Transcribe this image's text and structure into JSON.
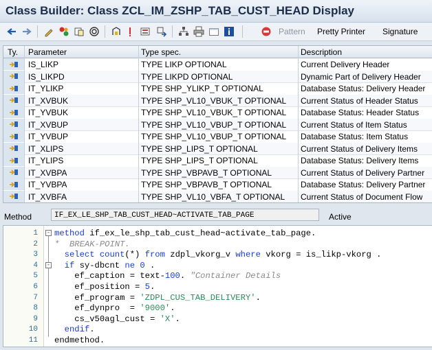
{
  "window": {
    "title": "Class Builder: Class ZCL_IM_ZSHP_TAB_CUST_HEAD Display"
  },
  "toolbar": {
    "icons": [
      "back-icon",
      "forward-icon",
      "edit-icon",
      "display-change-icon",
      "activate-icon",
      "where-used-icon",
      "test-icon",
      "object-list-icon",
      "breakpoint-icon",
      "navigate-icon",
      "hierarchy-icon",
      "print-icon",
      "fullscreen-icon",
      "info-icon",
      "pattern-icon"
    ],
    "pattern_label": "Pattern",
    "pretty_printer_label": "Pretty Printer",
    "signature_label": "Signature"
  },
  "params": {
    "headers": {
      "ty": "Ty.",
      "parameter": "Parameter",
      "type_spec": "Type spec.",
      "description": "Description"
    },
    "rows": [
      {
        "name": "IS_LIKP",
        "type": "TYPE LIKP OPTIONAL",
        "desc": "Current Delivery Header"
      },
      {
        "name": "IS_LIKPD",
        "type": "TYPE LIKPD OPTIONAL",
        "desc": "Dynamic Part of Delivery Header"
      },
      {
        "name": "IT_YLIKP",
        "type": "TYPE SHP_YLIKP_T OPTIONAL",
        "desc": "Database Status: Delivery Header"
      },
      {
        "name": "IT_XVBUK",
        "type": "TYPE SHP_VL10_VBUK_T OPTIONAL",
        "desc": "Current Status of Header Status"
      },
      {
        "name": "IT_YVBUK",
        "type": "TYPE SHP_VL10_VBUK_T OPTIONAL",
        "desc": "Database Status: Header Status"
      },
      {
        "name": "IT_XVBUP",
        "type": "TYPE SHP_VL10_VBUP_T OPTIONAL",
        "desc": "Current Status of Item Status"
      },
      {
        "name": "IT_YVBUP",
        "type": "TYPE SHP_VL10_VBUP_T OPTIONAL",
        "desc": "Database Status: Item Status"
      },
      {
        "name": "IT_XLIPS",
        "type": "TYPE SHP_LIPS_T OPTIONAL",
        "desc": "Current Status of Delivery Items"
      },
      {
        "name": "IT_YLIPS",
        "type": "TYPE SHP_LIPS_T OPTIONAL",
        "desc": "Database Status: Delivery Items"
      },
      {
        "name": "IT_XVBPA",
        "type": "TYPE SHP_VBPAVB_T OPTIONAL",
        "desc": "Current Status of Delivery Partner"
      },
      {
        "name": "IT_YVBPA",
        "type": "TYPE SHP_VBPAVB_T OPTIONAL",
        "desc": "Database Status: Delivery Partner"
      },
      {
        "name": "IT_XVBFA",
        "type": "TYPE SHP_VL10_VBFA_T OPTIONAL",
        "desc": "Current Status of Document Flow"
      }
    ]
  },
  "method_bar": {
    "label": "Method",
    "value": "IF_EX_LE_SHP_TAB_CUST_HEAD~ACTIVATE_TAB_PAGE",
    "status": "Active"
  },
  "editor": {
    "line_numbers": [
      "1",
      "2",
      "3",
      "4",
      "5",
      "6",
      "7",
      "8",
      "9",
      "10",
      "11"
    ],
    "lines": [
      [
        {
          "t": "method",
          "c": "kw"
        },
        {
          "t": " if_ex_le_shp_tab_cust_head~activate_tab_page.",
          "c": "id"
        }
      ],
      [
        {
          "t": "*  BREAK-POINT.",
          "c": "cm"
        }
      ],
      [
        {
          "t": "  ",
          "c": "id"
        },
        {
          "t": "select count",
          "c": "kw"
        },
        {
          "t": "(*) ",
          "c": "id"
        },
        {
          "t": "from",
          "c": "kw"
        },
        {
          "t": " zdpl_vkorg_v ",
          "c": "id"
        },
        {
          "t": "where",
          "c": "kw"
        },
        {
          "t": " vkorg = is_likp-vkorg .",
          "c": "id"
        }
      ],
      [
        {
          "t": "  ",
          "c": "id"
        },
        {
          "t": "if",
          "c": "kw"
        },
        {
          "t": " sy-dbcnt ",
          "c": "id"
        },
        {
          "t": "ne",
          "c": "kw"
        },
        {
          "t": " ",
          "c": "id"
        },
        {
          "t": "0",
          "c": "num"
        },
        {
          "t": " .",
          "c": "id"
        }
      ],
      [
        {
          "t": "    ef_caption = text-",
          "c": "id"
        },
        {
          "t": "100",
          "c": "num"
        },
        {
          "t": ". ",
          "c": "id"
        },
        {
          "t": "\"Container Details",
          "c": "cm"
        }
      ],
      [
        {
          "t": "    ef_position = ",
          "c": "id"
        },
        {
          "t": "5",
          "c": "num"
        },
        {
          "t": ".",
          "c": "id"
        }
      ],
      [
        {
          "t": "    ef_program = ",
          "c": "id"
        },
        {
          "t": "'ZDPL_CUS_TAB_DELIVERY'",
          "c": "str"
        },
        {
          "t": ".",
          "c": "id"
        }
      ],
      [
        {
          "t": "    ef_dynpro  = ",
          "c": "id"
        },
        {
          "t": "'9000'",
          "c": "str"
        },
        {
          "t": ".",
          "c": "id"
        }
      ],
      [
        {
          "t": "    cs_v50agl_cust = ",
          "c": "id"
        },
        {
          "t": "'X'",
          "c": "str"
        },
        {
          "t": ".",
          "c": "id"
        }
      ],
      [
        {
          "t": "  ",
          "c": "id"
        },
        {
          "t": "endif",
          "c": "kw"
        },
        {
          "t": ".",
          "c": "id"
        }
      ],
      [
        {
          "t": "endmethod.",
          "c": "id"
        }
      ]
    ]
  }
}
